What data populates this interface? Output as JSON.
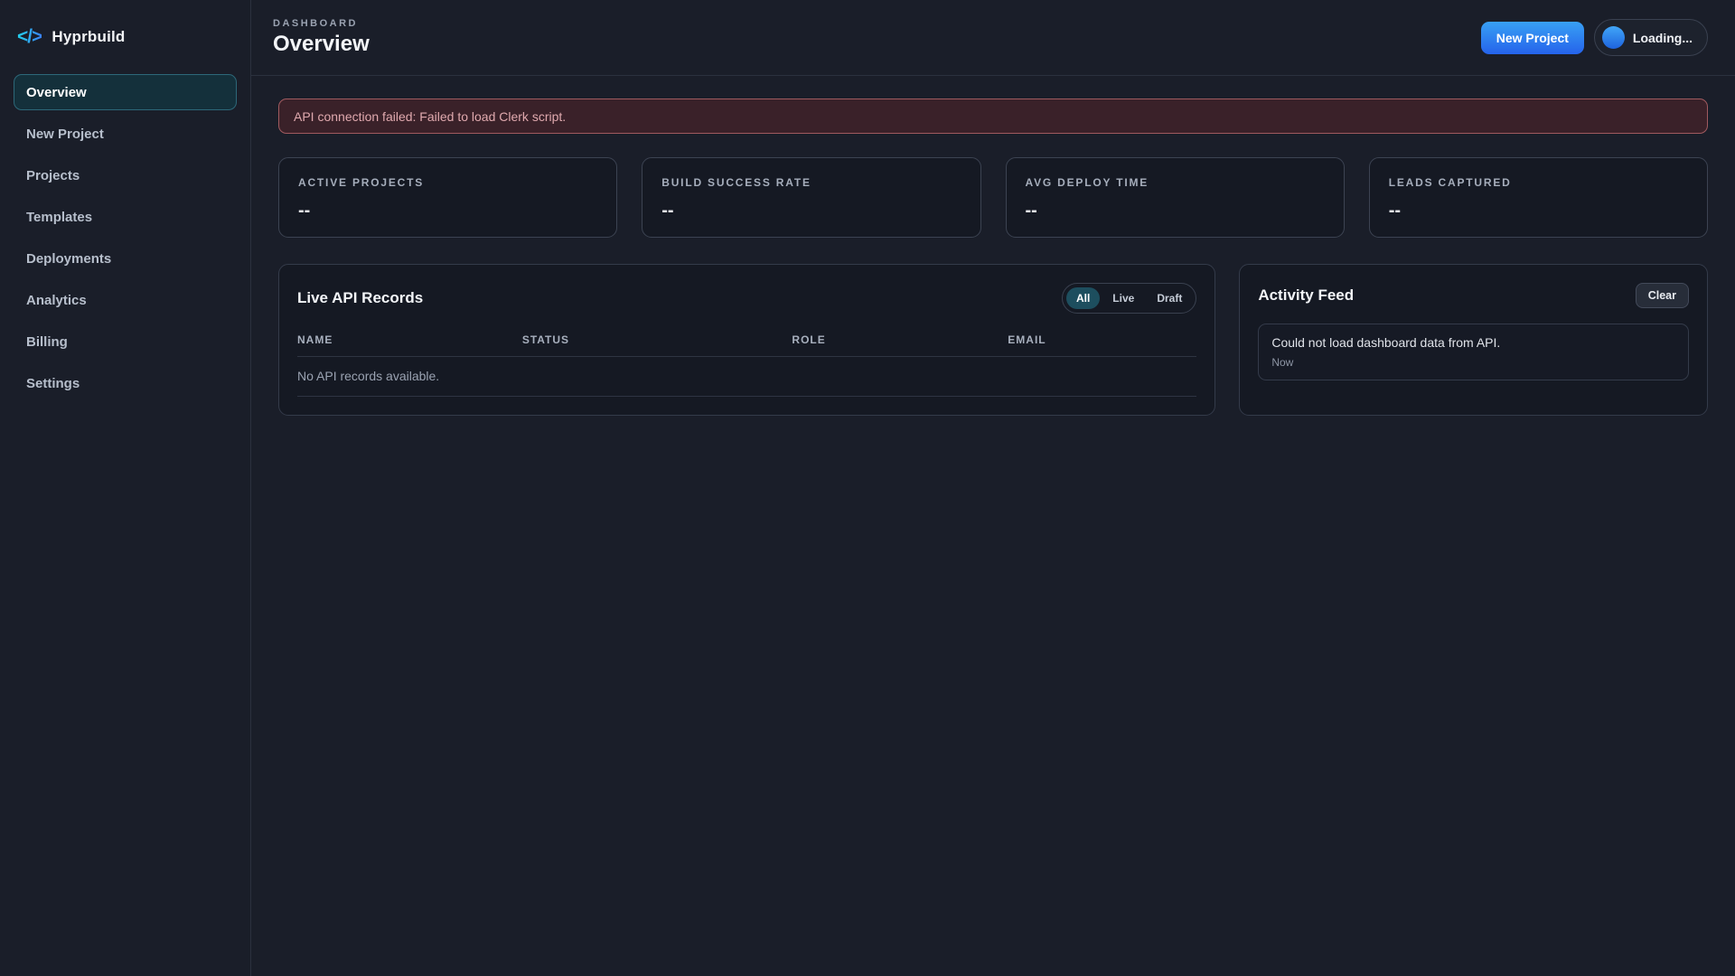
{
  "app": {
    "name": "Hyprbuild",
    "logo_glyph": "</>"
  },
  "sidebar": {
    "items": [
      {
        "label": "Overview",
        "active": true
      },
      {
        "label": "New Project",
        "active": false
      },
      {
        "label": "Projects",
        "active": false
      },
      {
        "label": "Templates",
        "active": false
      },
      {
        "label": "Deployments",
        "active": false
      },
      {
        "label": "Analytics",
        "active": false
      },
      {
        "label": "Billing",
        "active": false
      },
      {
        "label": "Settings",
        "active": false
      }
    ]
  },
  "header": {
    "eyebrow": "DASHBOARD",
    "title": "Overview",
    "new_project_label": "New Project",
    "user_label": "Loading..."
  },
  "alert": {
    "message": "API connection failed: Failed to load Clerk script."
  },
  "stats": [
    {
      "label": "ACTIVE PROJECTS",
      "value": "--"
    },
    {
      "label": "BUILD SUCCESS RATE",
      "value": "--"
    },
    {
      "label": "AVG DEPLOY TIME",
      "value": "--"
    },
    {
      "label": "LEADS CAPTURED",
      "value": "--"
    }
  ],
  "records": {
    "title": "Live API Records",
    "filters": [
      {
        "label": "All",
        "active": true
      },
      {
        "label": "Live",
        "active": false
      },
      {
        "label": "Draft",
        "active": false
      }
    ],
    "columns": [
      "NAME",
      "STATUS",
      "ROLE",
      "EMAIL"
    ],
    "empty_message": "No API records available."
  },
  "activity": {
    "title": "Activity Feed",
    "clear_label": "Clear",
    "entries": [
      {
        "message": "Could not load dashboard data from API.",
        "time": "Now"
      }
    ]
  },
  "theme": {
    "accent_blue": "#2563eb",
    "accent_blue_light": "#38a0f4",
    "logo_gradient_start": "#22d3ee",
    "logo_gradient_end": "#3b82f6",
    "active_nav_bg": "#14303b",
    "active_nav_border": "#2d6879",
    "active_filter_bg": "#1d4e5e",
    "error_bg": "#3a2129",
    "error_border": "#a05a5f",
    "error_text": "#e0a9ae",
    "page_bg": "#1a1e29",
    "card_bg": "#151923"
  }
}
